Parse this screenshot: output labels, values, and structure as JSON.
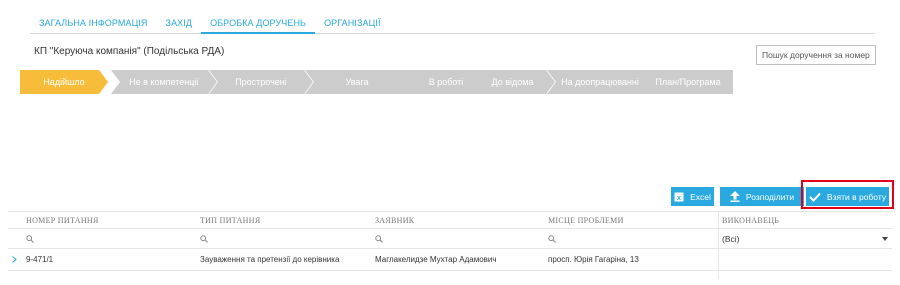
{
  "tabs": [
    {
      "label": "ЗАГАЛЬНА ІНФОРМАЦІЯ",
      "active": false
    },
    {
      "label": "ЗАХІД",
      "active": false
    },
    {
      "label": "ОБРОБКА ДОРУЧЕНЬ",
      "active": true
    },
    {
      "label": "ОРГАНІЗАЦІЇ",
      "active": false
    }
  ],
  "organization": "КП \"Керуюча компанія\" (Подільська РДА)",
  "search": {
    "placeholder": "Пошук доручення за номером",
    "value": ""
  },
  "statuses": [
    {
      "label": "Надійшло",
      "active": true
    },
    {
      "label": "Не в компетенції",
      "active": false
    },
    {
      "label": "Прострочені",
      "active": false
    },
    {
      "label": "Увага",
      "active": false
    },
    {
      "label": "В роботі",
      "active": false
    },
    {
      "label": "До відома",
      "active": false
    },
    {
      "label": "На доопрацюванні",
      "active": false
    },
    {
      "label": "План/Програма",
      "active": false
    }
  ],
  "actions": {
    "excel_label": "Excel",
    "distribute_label": "Розподілити",
    "take_label": "Взяти в роботу"
  },
  "table": {
    "columns": [
      "НОМЕР ПИТАННЯ",
      "ТИП ПИТАННЯ",
      "ЗАЯВНИК",
      "МІСЦЕ ПРОБЛЕМИ",
      "ВИКОНАВЕЦЬ"
    ],
    "executor_filter": "(Всі)",
    "rows": [
      {
        "number": "9-471/1",
        "type": "Зауваження та претензії до керівника",
        "applicant": "Маглакелидзе Мухтар Адамович",
        "location": "просп. Юрія Гагаріна, 13",
        "executor": ""
      }
    ]
  },
  "colors": {
    "accent": "#29a9e0",
    "status_active": "#f7bd3a",
    "status_inactive": "#cccccc",
    "highlight": "#e3001b"
  },
  "icons": {
    "excel": "excel-icon",
    "distribute": "upload-arrow-icon",
    "take": "check-icon",
    "filter": "search-icon",
    "dropdown": "caret-down-icon",
    "expand": "chevron-right-icon"
  }
}
